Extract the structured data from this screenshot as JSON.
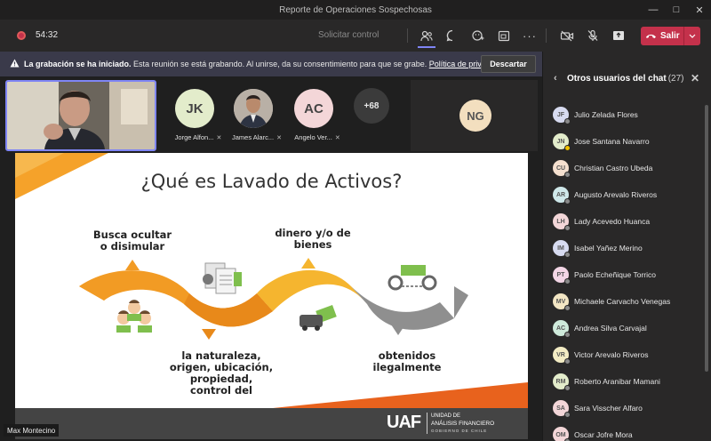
{
  "window": {
    "title": "Reporte de Operaciones Sospechosas"
  },
  "toolbar": {
    "timer": "54:32",
    "request_control": "Solicitar control",
    "leave_label": "Salir",
    "icons": [
      "people-icon",
      "chat-icon",
      "reactions-icon",
      "share-tray-icon",
      "more-icon",
      "camera-off-icon",
      "mic-off-icon",
      "share-icon"
    ]
  },
  "banner": {
    "bold": "La grabación se ha iniciado.",
    "text": " Esta reunión se está grabando. Al unirse, da su consentimiento para que se grabe. ",
    "link": "Política de privacidad",
    "dismiss": "Descartar"
  },
  "participants": [
    {
      "initials": "JK",
      "name": "Jorge Alfon...",
      "color": "#e3eccb"
    },
    {
      "initials": "",
      "name": "James Alarc...",
      "color": "#8a7a6a"
    },
    {
      "initials": "AC",
      "name": "Angelo Ver...",
      "color": "#f3d6d8"
    }
  ],
  "more_count": "+68",
  "ng_tile": {
    "initials": "NG"
  },
  "presenter": "Max Montecino",
  "slide": {
    "title": "¿Qué es Lavado de Activos?",
    "t1": "Busca ocultar o disimular",
    "t2": "dinero y/o de bienes",
    "t3": "la naturaleza, origen, ubicación, propiedad, control del",
    "t4": "obtenidos ilegalmente",
    "logo_text": "UAF",
    "logo_sub1": "UNIDAD DE",
    "logo_sub2": "ANÁLISIS FINANCIERO",
    "logo_sub3": "GOBIERNO DE CHILE"
  },
  "panel": {
    "title": "Otros usuarios del chat",
    "count": "(27)",
    "people": [
      {
        "initials": "JF",
        "name": "Julio Zelada Flores",
        "color": "#d7dbf0",
        "status": "#8a8a8a"
      },
      {
        "initials": "JN",
        "name": "Jose Santana Navarro",
        "color": "#e3eccb",
        "status": "#f0c000"
      },
      {
        "initials": "CU",
        "name": "Christian Castro Ubeda",
        "color": "#f5e0cf",
        "status": "#8a8a8a"
      },
      {
        "initials": "AR",
        "name": "Augusto Arevalo Riveros",
        "color": "#cfe8ea",
        "status": "#8a8a8a"
      },
      {
        "initials": "LH",
        "name": "Lady Acevedo Huanca",
        "color": "#f3d6d8",
        "status": "#8a8a8a"
      },
      {
        "initials": "IM",
        "name": "Isabel Yañez Merino",
        "color": "#d7dbf0",
        "status": "#8a8a8a"
      },
      {
        "initials": "PT",
        "name": "Paolo Echeñique Torrico",
        "color": "#f3d6e6",
        "status": "#8a8a8a"
      },
      {
        "initials": "MV",
        "name": "Michaele Carvacho Venegas",
        "color": "#f3e6c4",
        "status": "#8a8a8a"
      },
      {
        "initials": "AC",
        "name": "Andrea Silva Carvajal",
        "color": "#cfeadb",
        "status": "#8a8a8a"
      },
      {
        "initials": "VR",
        "name": "Victor Arevalo Riveros",
        "color": "#f3ecc4",
        "status": "#8a8a8a"
      },
      {
        "initials": "RM",
        "name": "Roberto Aranibar Mamani",
        "color": "#e3eccb",
        "status": "#8a8a8a"
      },
      {
        "initials": "SA",
        "name": "Sara Visscher Alfaro",
        "color": "#f3d6d8",
        "status": "#8a8a8a"
      },
      {
        "initials": "OM",
        "name": "Oscar Jofre Mora",
        "color": "#f3d6d8",
        "status": "#8a8a8a"
      }
    ]
  }
}
